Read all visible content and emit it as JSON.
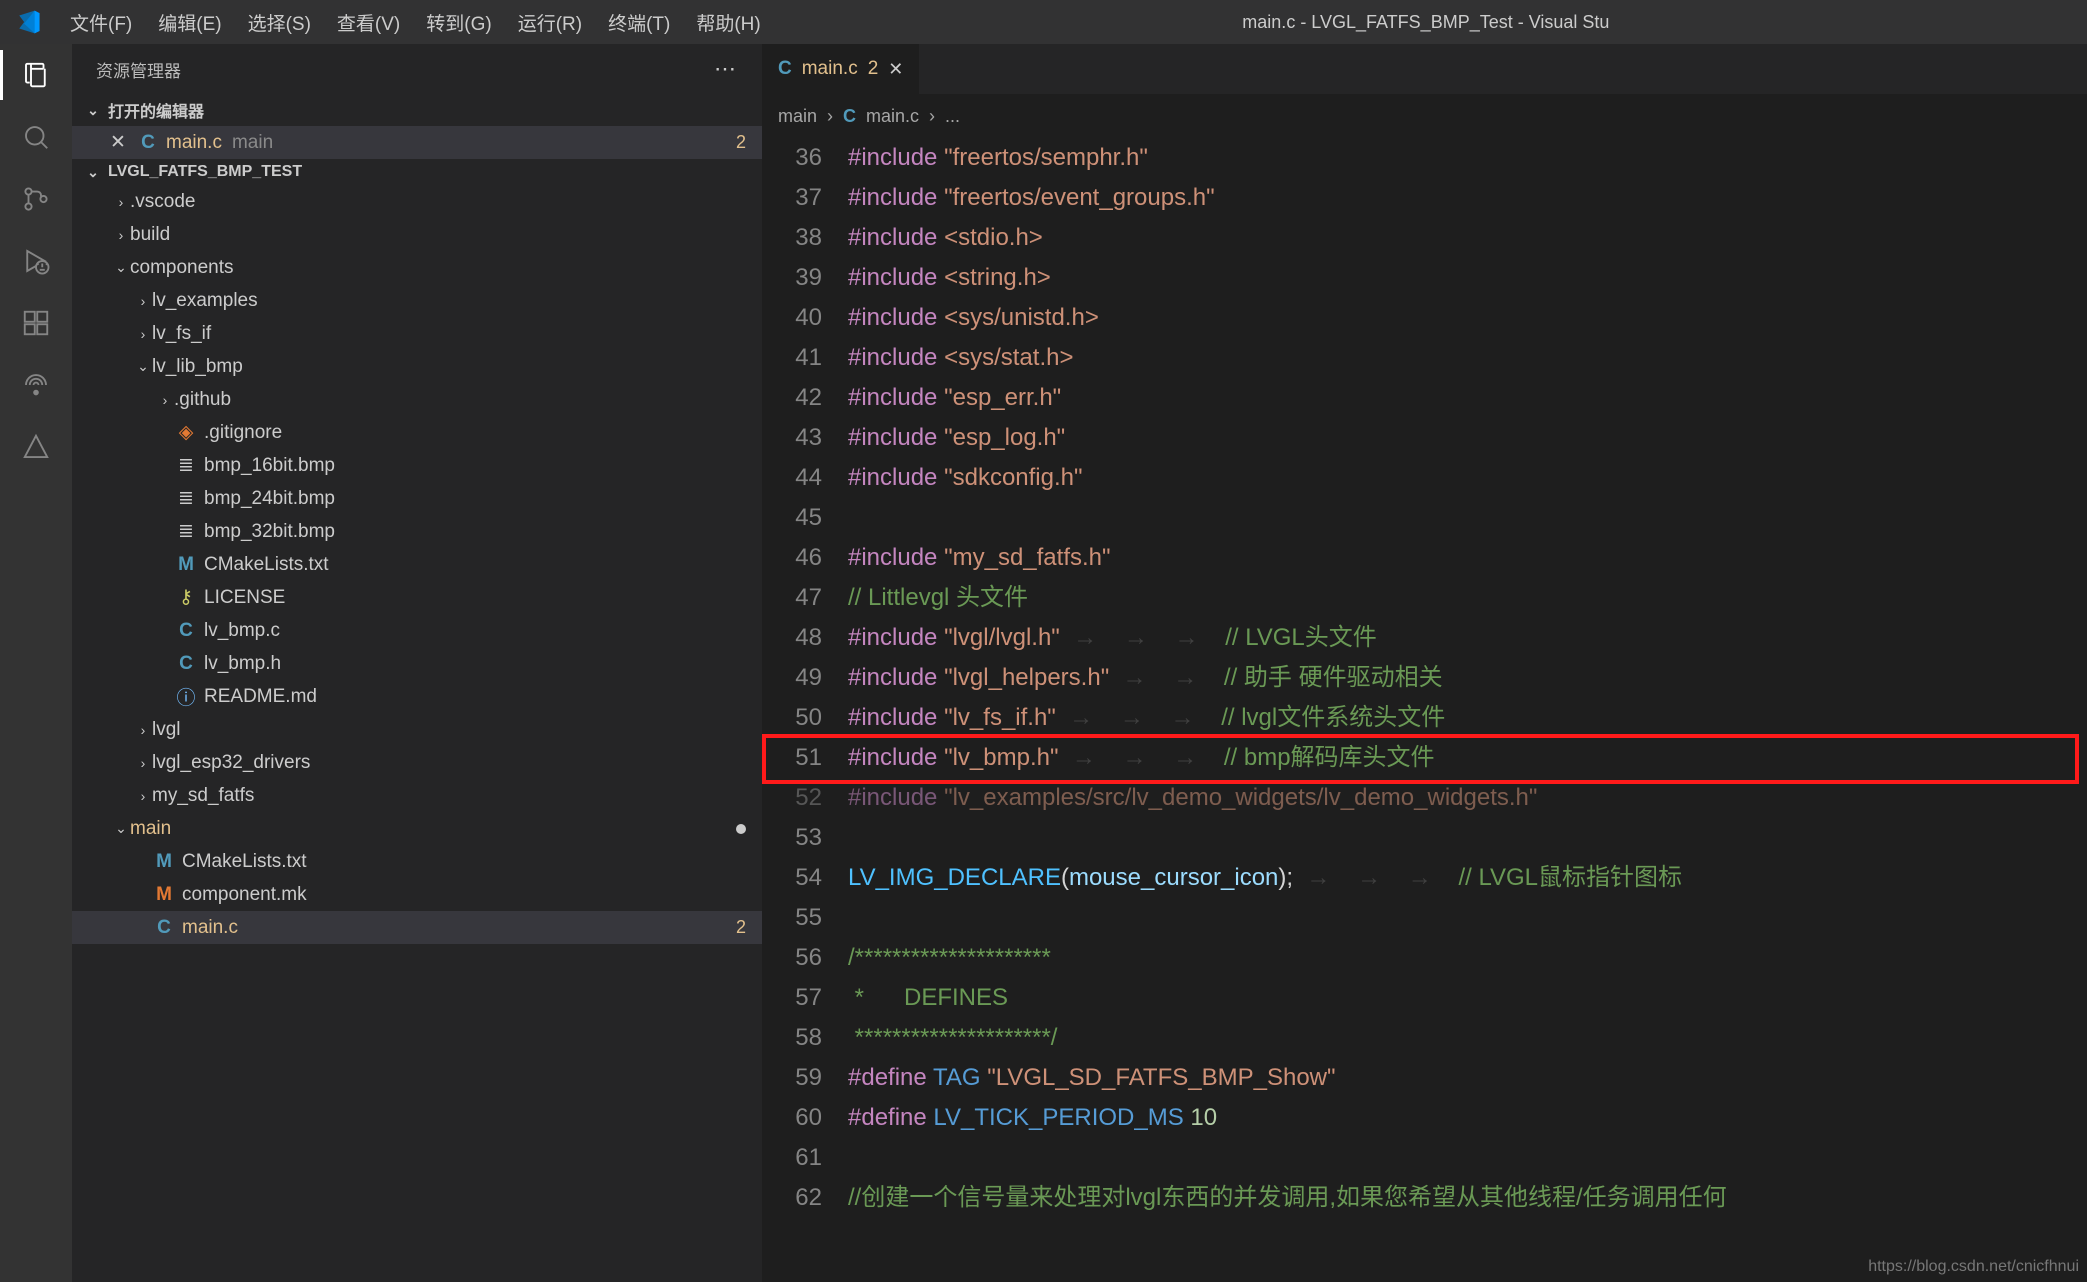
{
  "menubar": [
    "文件(F)",
    "编辑(E)",
    "选择(S)",
    "查看(V)",
    "转到(G)",
    "运行(R)",
    "终端(T)",
    "帮助(H)"
  ],
  "window_title": "main.c - LVGL_FATFS_BMP_Test - Visual Stu",
  "sidebar": {
    "title": "资源管理器",
    "open_editors_label": "打开的编辑器",
    "open_editors": [
      {
        "name": "main.c",
        "folder": "main",
        "badge": "2"
      }
    ],
    "project_name": "LVGL_FATFS_BMP_TEST",
    "tree": [
      {
        "depth": 1,
        "kind": "folder-closed",
        "name": ".vscode"
      },
      {
        "depth": 1,
        "kind": "folder-closed",
        "name": "build"
      },
      {
        "depth": 1,
        "kind": "folder-open",
        "name": "components"
      },
      {
        "depth": 2,
        "kind": "folder-closed",
        "name": "lv_examples"
      },
      {
        "depth": 2,
        "kind": "folder-closed",
        "name": "lv_fs_if"
      },
      {
        "depth": 2,
        "kind": "folder-open",
        "name": "lv_lib_bmp"
      },
      {
        "depth": 3,
        "kind": "folder-closed",
        "name": ".github"
      },
      {
        "depth": 3,
        "kind": "gitignore",
        "name": ".gitignore"
      },
      {
        "depth": 3,
        "kind": "file",
        "name": "bmp_16bit.bmp"
      },
      {
        "depth": 3,
        "kind": "file",
        "name": "bmp_24bit.bmp"
      },
      {
        "depth": 3,
        "kind": "file",
        "name": "bmp_32bit.bmp"
      },
      {
        "depth": 3,
        "kind": "cmake",
        "name": "CMakeLists.txt"
      },
      {
        "depth": 3,
        "kind": "license",
        "name": "LICENSE"
      },
      {
        "depth": 3,
        "kind": "c",
        "name": "lv_bmp.c"
      },
      {
        "depth": 3,
        "kind": "c",
        "name": "lv_bmp.h"
      },
      {
        "depth": 3,
        "kind": "info",
        "name": "README.md"
      },
      {
        "depth": 2,
        "kind": "folder-closed",
        "name": "lvgl"
      },
      {
        "depth": 2,
        "kind": "folder-closed",
        "name": "lvgl_esp32_drivers"
      },
      {
        "depth": 2,
        "kind": "folder-closed",
        "name": "my_sd_fatfs"
      },
      {
        "depth": 1,
        "kind": "folder-open",
        "name": "main",
        "dim": true,
        "dot": true
      },
      {
        "depth": 2,
        "kind": "cmake",
        "name": "CMakeLists.txt"
      },
      {
        "depth": 2,
        "kind": "mk",
        "name": "component.mk"
      },
      {
        "depth": 2,
        "kind": "c",
        "name": "main.c",
        "active": true,
        "badge": "2"
      }
    ]
  },
  "tab": {
    "name": "main.c",
    "badge": "2"
  },
  "breadcrumb": [
    "main",
    "main.c",
    "..."
  ],
  "code_lines": [
    {
      "n": 36,
      "seg": [
        [
          "pp",
          "#include"
        ],
        [
          "ws",
          " "
        ],
        [
          "str",
          "\"freertos/semphr.h\""
        ]
      ]
    },
    {
      "n": 37,
      "seg": [
        [
          "pp",
          "#include"
        ],
        [
          "ws",
          " "
        ],
        [
          "str",
          "\"freertos/event_groups.h\""
        ]
      ]
    },
    {
      "n": 38,
      "seg": [
        [
          "pp",
          "#include"
        ],
        [
          "ws",
          " "
        ],
        [
          "ang",
          "<stdio.h>"
        ]
      ]
    },
    {
      "n": 39,
      "seg": [
        [
          "pp",
          "#include"
        ],
        [
          "ws",
          " "
        ],
        [
          "ang",
          "<string.h>"
        ]
      ]
    },
    {
      "n": 40,
      "seg": [
        [
          "pp",
          "#include"
        ],
        [
          "ws",
          " "
        ],
        [
          "ang",
          "<sys/unistd.h>"
        ]
      ]
    },
    {
      "n": 41,
      "seg": [
        [
          "pp",
          "#include"
        ],
        [
          "ws",
          " "
        ],
        [
          "ang",
          "<sys/stat.h>"
        ]
      ]
    },
    {
      "n": 42,
      "seg": [
        [
          "pp",
          "#include"
        ],
        [
          "ws",
          " "
        ],
        [
          "str",
          "\"esp_err.h\""
        ]
      ]
    },
    {
      "n": 43,
      "seg": [
        [
          "pp",
          "#include"
        ],
        [
          "ws",
          " "
        ],
        [
          "str",
          "\"esp_log.h\""
        ]
      ]
    },
    {
      "n": 44,
      "seg": [
        [
          "pp",
          "#include"
        ],
        [
          "ws",
          " "
        ],
        [
          "str",
          "\"sdkconfig.h\""
        ]
      ]
    },
    {
      "n": 45,
      "seg": []
    },
    {
      "n": 46,
      "seg": [
        [
          "pp",
          "#include"
        ],
        [
          "ws",
          " "
        ],
        [
          "str",
          "\"my_sd_fatfs.h\""
        ]
      ]
    },
    {
      "n": 47,
      "seg": [
        [
          "cmt",
          "// Littlevgl "
        ],
        [
          "cmt",
          "头文件"
        ]
      ]
    },
    {
      "n": 48,
      "seg": [
        [
          "pp",
          "#include"
        ],
        [
          "ws",
          " "
        ],
        [
          "str",
          "\"lvgl/lvgl.h\""
        ],
        [
          "ws",
          "  →    →    →    "
        ],
        [
          "cmt",
          "// LVGL头文件"
        ]
      ]
    },
    {
      "n": 49,
      "seg": [
        [
          "pp",
          "#include"
        ],
        [
          "ws",
          " "
        ],
        [
          "str",
          "\"lvgl_helpers.h\""
        ],
        [
          "ws",
          "  →    →    "
        ],
        [
          "cmt",
          "// 助手 硬件驱动相关"
        ]
      ]
    },
    {
      "n": 50,
      "seg": [
        [
          "pp",
          "#include"
        ],
        [
          "ws",
          " "
        ],
        [
          "str",
          "\"lv_fs_if.h\""
        ],
        [
          "ws",
          "  →    →    →    "
        ],
        [
          "cmt",
          "// lvgl文件系统头文件"
        ]
      ]
    },
    {
      "n": 51,
      "seg": [
        [
          "pp",
          "#include"
        ],
        [
          "ws",
          " "
        ],
        [
          "str",
          "\"lv_bmp.h\""
        ],
        [
          "ws",
          "  →    →    →    "
        ],
        [
          "cmt",
          "// bmp解码库头文件"
        ]
      ]
    },
    {
      "n": 52,
      "seg": [
        [
          "pp",
          "#include"
        ],
        [
          "ws",
          " "
        ],
        [
          "str",
          "\"lv_examples/src/lv_demo_widgets/lv_demo_widgets.h\""
        ]
      ],
      "dim": true
    },
    {
      "n": 53,
      "seg": []
    },
    {
      "n": 54,
      "seg": [
        [
          "mac",
          "LV_IMG_DECLARE"
        ],
        [
          "pl",
          "("
        ],
        [
          "id",
          "mouse_cursor_icon"
        ],
        [
          "pl",
          ");"
        ],
        [
          "ws",
          "  →    →    →    "
        ],
        [
          "cmt",
          "// LVGL鼠标指针图标"
        ]
      ]
    },
    {
      "n": 55,
      "seg": []
    },
    {
      "n": 56,
      "seg": [
        [
          "cmt",
          "/*********************"
        ]
      ]
    },
    {
      "n": 57,
      "seg": [
        [
          "cmt",
          " *      DEFINES"
        ]
      ]
    },
    {
      "n": 58,
      "seg": [
        [
          "cmt",
          " *********************/"
        ]
      ]
    },
    {
      "n": 59,
      "seg": [
        [
          "pp",
          "#define"
        ],
        [
          "ws",
          " "
        ],
        [
          "def",
          "TAG"
        ],
        [
          "ws",
          " "
        ],
        [
          "str",
          "\"LVGL_SD_FATFS_BMP_Show\""
        ]
      ]
    },
    {
      "n": 60,
      "seg": [
        [
          "pp",
          "#define"
        ],
        [
          "ws",
          " "
        ],
        [
          "def",
          "LV_TICK_PERIOD_MS"
        ],
        [
          "ws",
          " "
        ],
        [
          "num",
          "10"
        ]
      ]
    },
    {
      "n": 61,
      "seg": []
    },
    {
      "n": 62,
      "seg": [
        [
          "cmt",
          "//创建一个信号量来处理对lvgl东西的并发调用,如果您希望从其他线程/任务调用任何"
        ]
      ]
    }
  ],
  "watermark": "https://blog.csdn.net/cnicfhnui"
}
